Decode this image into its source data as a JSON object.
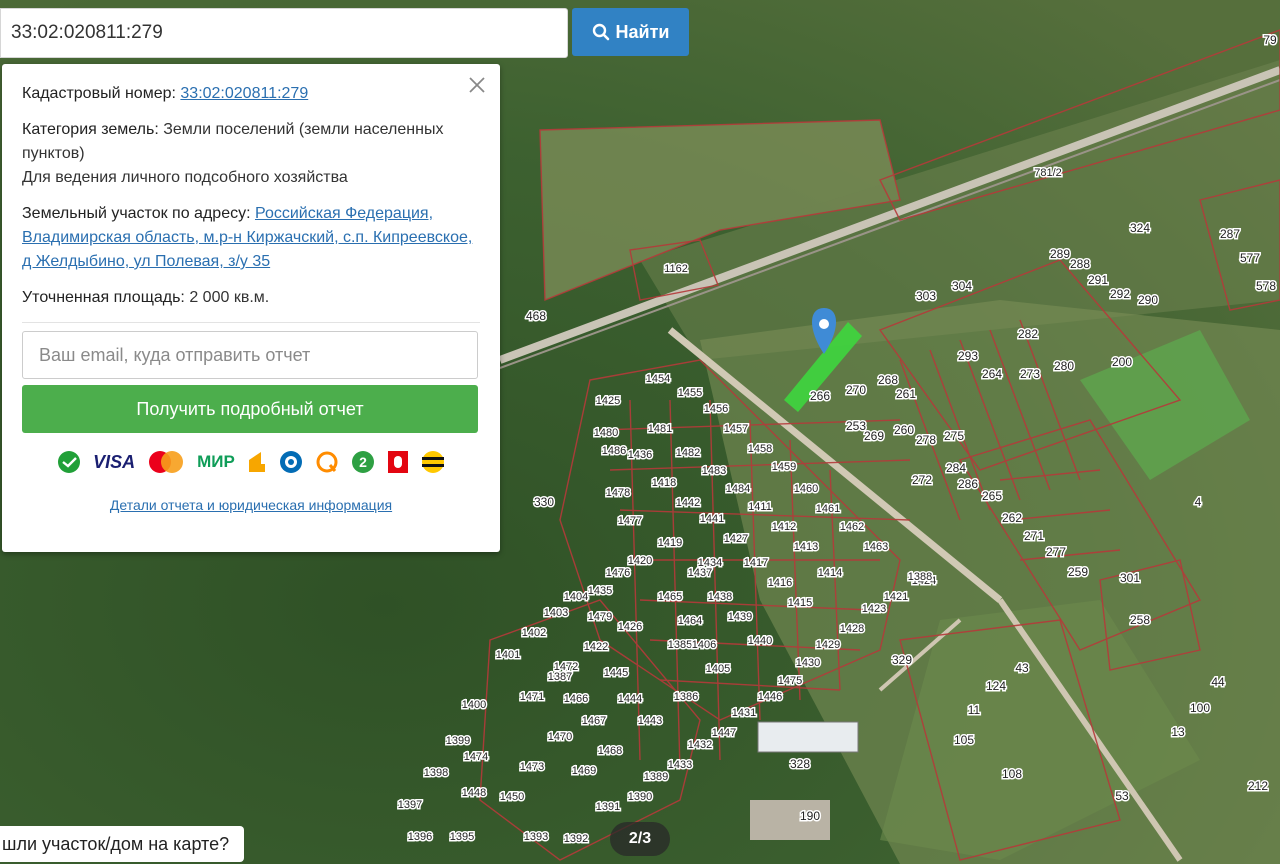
{
  "search": {
    "value": "33:02:020811:279",
    "button_label": "Найти"
  },
  "popup": {
    "cadastral_label": "Кадастровый номер:",
    "cadastral_value": "33:02:020811:279",
    "category_label": "Категория земель:",
    "category_value": "Земли поселений (земли населенных пунктов)",
    "usage": "Для ведения личного подсобного хозяйства",
    "address_label": "Земельный участок по адресу:",
    "address_value": "Российская Федерация, Владимирская область, м.р-н Киржачский, с.п. Кипреевское, д Желдыбино, ул Полевая, з/у 35",
    "area_label": "Уточненная площадь:",
    "area_value": "2 000 кв.м.",
    "email_placeholder": "Ваш email, куда отправить отчет",
    "report_button": "Получить подробный отчет",
    "payment_icons": [
      "sberbank-icon",
      "visa-icon",
      "mastercard-icon",
      "mir-icon",
      "yandex-money-icon",
      "webmoney-icon",
      "qiwi-icon",
      "alfa-icon",
      "mts-icon",
      "beeline-icon"
    ],
    "visa_text": "VISA",
    "mir_text": "МИР",
    "details_link": "Детали отчета и юридическая информация"
  },
  "map": {
    "plot_labels": [
      "1162",
      "781/2",
      "79",
      "324",
      "287",
      "577",
      "578",
      "289",
      "288",
      "291",
      "292",
      "290",
      "303",
      "304",
      "468",
      "282",
      "293",
      "264",
      "273",
      "280",
      "200",
      "1454",
      "1425",
      "1455",
      "1456",
      "1457",
      "1458",
      "1459",
      "1460",
      "1461",
      "1462",
      "1463",
      "1480",
      "1481",
      "1482",
      "1483",
      "1484",
      "1486",
      "1418",
      "1442",
      "1441",
      "1411",
      "1412",
      "1413",
      "1414",
      "1415",
      "1416",
      "1417",
      "1419",
      "1420",
      "1421",
      "1422",
      "1423",
      "1424",
      "1426",
      "1427",
      "1428",
      "1429",
      "1430",
      "1431",
      "1432",
      "1433",
      "1434",
      "1435",
      "1436",
      "1437",
      "1438",
      "1439",
      "1440",
      "1443",
      "1444",
      "1445",
      "1446",
      "1447",
      "1448",
      "1450",
      "1464",
      "1465",
      "1466",
      "1467",
      "1468",
      "1469",
      "1470",
      "1471",
      "1472",
      "1473",
      "1474",
      "1475",
      "1476",
      "1477",
      "1478",
      "1479",
      "1385",
      "1386",
      "1387",
      "1388",
      "1389",
      "1390",
      "1391",
      "1392",
      "1393",
      "1395",
      "1396",
      "1397",
      "1398",
      "1399",
      "1400",
      "1401",
      "1402",
      "1403",
      "1404",
      "1405",
      "1406",
      "266",
      "270",
      "268",
      "261",
      "253",
      "269",
      "260",
      "278",
      "275",
      "272",
      "284",
      "286",
      "265",
      "262",
      "271",
      "277",
      "259",
      "301",
      "258",
      "330",
      "329",
      "328",
      "190",
      "4",
      "11",
      "105",
      "108",
      "124",
      "43",
      "44",
      "100",
      "13",
      "53",
      "212"
    ],
    "highlighted_plot": "266",
    "marker_color": "#3f8bd6",
    "highlight_color": "#3ed63e",
    "boundary_color": "#b53a3a"
  },
  "bottom": {
    "found_text": "шли участок/дом на карте?",
    "page_indicator": "2/3"
  }
}
